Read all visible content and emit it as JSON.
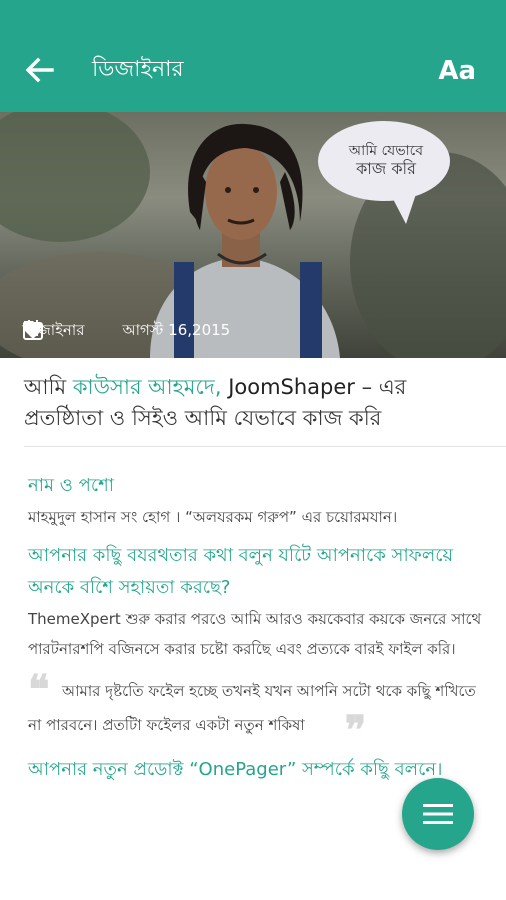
{
  "appbar": {
    "title": "ডিজাইনার",
    "text_size_label": "Aa"
  },
  "hero": {
    "speech_bubble_line1": "আমি যেভাবে",
    "speech_bubble_line2": "কাজ করি",
    "category": "ডিজাইনার",
    "date": "আগস্ট 16,2015"
  },
  "article": {
    "headline_prefix": "আমি ",
    "headline_name": "কাউসার আহমদে,",
    "headline_brand": " JoomShaper",
    "headline_suffix": " – এর প্রতষ্ঠিাতা ও সিইও আমি যেভাবে কাজ করি",
    "q1": "নাম ও পশো",
    "a1": "মাহমুদুল হাসান সং হোগ । “অলযরকম গরুপ” এর চয়োরমযান।",
    "q2": "আপনার কছিু বযরথতার কথা বলুন যটেি আপনাকে সাফলয়ে অনকে বশেি সহায়তা করছে?",
    "a2": "ThemeXpert শুরু করার পরওে আমি আরও কয়কেবার কয়কে জনরে সাথে পারটনারশপি বজিনসে করার চষ্টো করছেি এবং প্রত্যকে বারই ফাইল করি।",
    "quote_open": "❝",
    "quote": "আমার দৃষ্টতিে ফইেল হচ্ছে তখনই যখন আপনি সটো থকে কছিু শখিতে না পারবনে। প্রতটাি ফইেলর একটা নতুন শকিষা",
    "quote_close": "❞",
    "q3": "আপনার নতুন প্রডোক্ট “OnePager” সম্পর্কে কছিু বলনে।"
  },
  "colors": {
    "accent": "#25a58c"
  },
  "icons": [
    "arrow-back-icon",
    "text-size-icon",
    "tag-icon",
    "calendar-icon",
    "menu-icon"
  ]
}
